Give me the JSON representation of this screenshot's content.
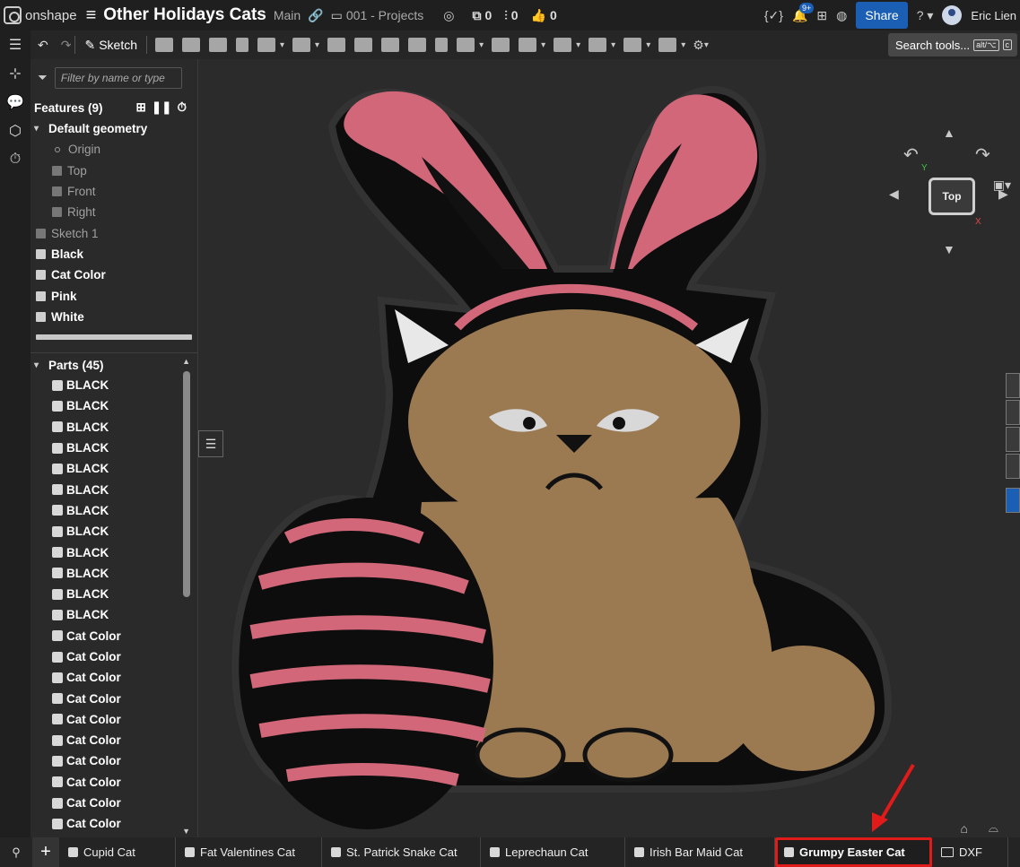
{
  "app": {
    "name": "onshape"
  },
  "document": {
    "title": "Other Holidays Cats",
    "branch": "Main",
    "folder": "001 - Projects"
  },
  "header": {
    "counts": [
      "0",
      "0",
      "0"
    ],
    "notification_badge": "9+",
    "share_label": "Share",
    "user_name": "Eric Lien"
  },
  "toolbar": {
    "sketch_label": "Sketch",
    "search_placeholder": "Search tools...",
    "search_shortcut": "alt/⌥",
    "search_shortcut2": "c"
  },
  "feature_panel": {
    "filter_placeholder": "Filter by name or type",
    "features_label": "Features (9)",
    "default_geometry_label": "Default geometry",
    "default_items": [
      "Origin",
      "Top",
      "Front",
      "Right"
    ],
    "features": [
      "Sketch 1",
      "Black",
      "Cat Color",
      "Pink",
      "White"
    ]
  },
  "parts_panel": {
    "parts_label": "Parts (45)",
    "parts": [
      "BLACK",
      "BLACK",
      "BLACK",
      "BLACK",
      "BLACK",
      "BLACK",
      "BLACK",
      "BLACK",
      "BLACK",
      "BLACK",
      "BLACK",
      "BLACK",
      "Cat Color",
      "Cat Color",
      "Cat Color",
      "Cat Color",
      "Cat Color",
      "Cat Color",
      "Cat Color",
      "Cat Color",
      "Cat Color",
      "Cat Color"
    ]
  },
  "view_cube": {
    "face_label": "Top",
    "axis_y": "Y",
    "axis_x": "X"
  },
  "tabs": [
    {
      "label": "Cupid Cat",
      "active": false
    },
    {
      "label": "Fat Valentines Cat",
      "active": false
    },
    {
      "label": "St. Patrick Snake Cat",
      "active": false
    },
    {
      "label": "Leprechaun Cat",
      "active": false
    },
    {
      "label": "Irish Bar Maid Cat",
      "active": false
    },
    {
      "label": "Grumpy Easter Cat",
      "active": true
    },
    {
      "label": "DXF",
      "active": false
    }
  ],
  "colors": {
    "accent": "#1a5fb4",
    "cat_fur": "#9b7a52",
    "pink": "#d16779",
    "outline": "#0d0d0d",
    "highlight": "#e11a1a"
  }
}
